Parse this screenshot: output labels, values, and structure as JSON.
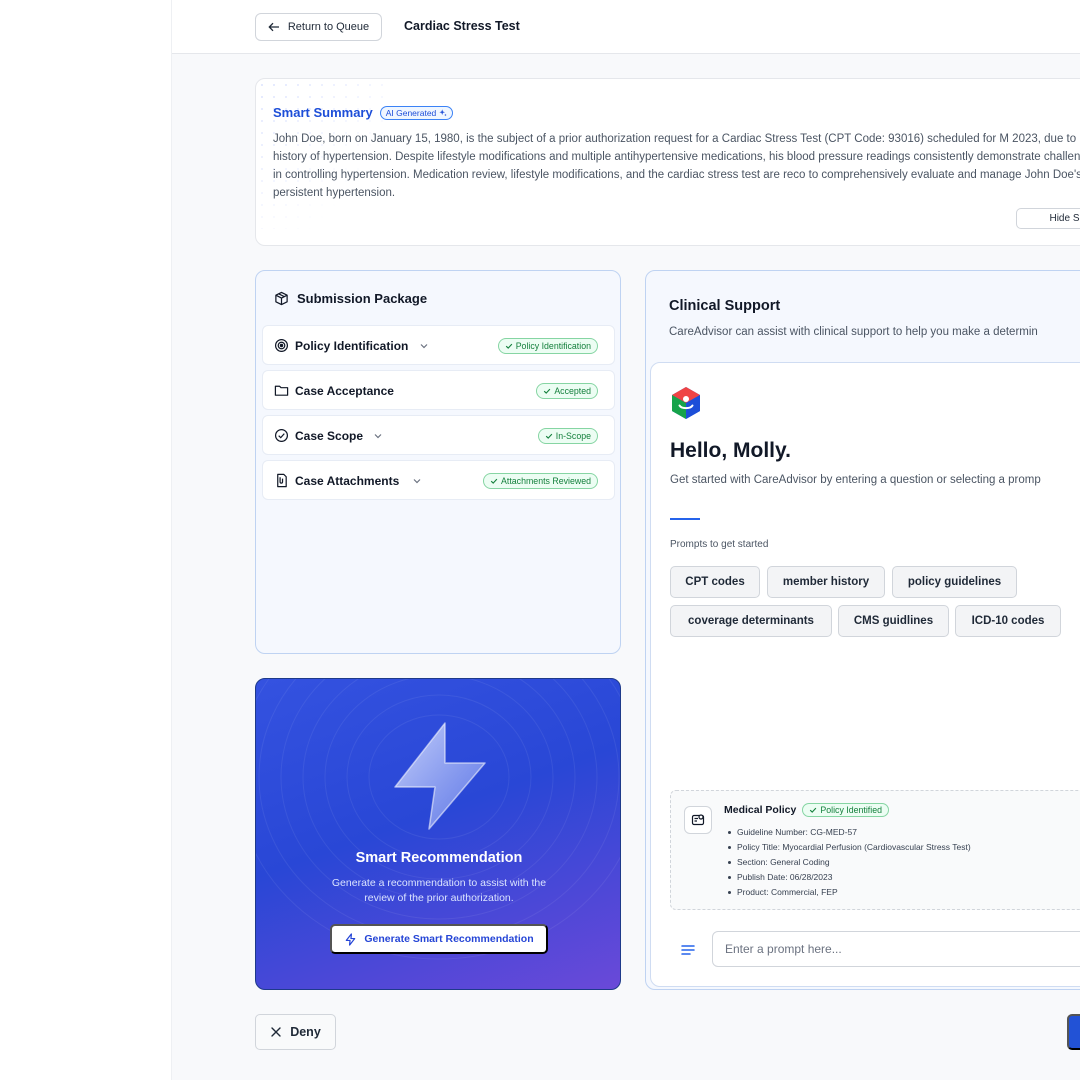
{
  "header": {
    "return_label": "Return to Queue",
    "page_title": "Cardiac Stress Test"
  },
  "summary": {
    "title": "Smart Summary",
    "badge": "AI Generated",
    "text": "John Doe, born on January 15, 1980, is the subject of a prior authorization request for a Cardiac Stress Test (CPT Code: 93016) scheduled for M 2023, due to his history of hypertension. Despite lifestyle modifications and multiple antihypertensive medications, his blood pressure readings consistently demonstrate challenges in controlling hypertension. Medication review, lifestyle modifications, and the cardiac stress test are reco to comprehensively evaluate and manage John Doe's persistent hypertension.",
    "hide_label": "Hide Smart"
  },
  "package": {
    "title": "Submission Package",
    "items": [
      {
        "label": "Policy Identification",
        "status": "Policy Identification",
        "icon": "target-icon",
        "expandable": true
      },
      {
        "label": "Case Acceptance",
        "status": "Accepted",
        "icon": "folder-icon",
        "expandable": false
      },
      {
        "label": "Case Scope",
        "status": "In-Scope",
        "icon": "check-circle-icon",
        "expandable": true
      },
      {
        "label": "Case Attachments",
        "status": "Attachments Reviewed",
        "icon": "attachment-icon",
        "expandable": true
      }
    ]
  },
  "recommendation": {
    "title": "Smart Recommendation",
    "description": "Generate a recommendation to assist with the review of the prior authorization.",
    "button_label": "Generate Smart Recommendation"
  },
  "clinical": {
    "title": "Clinical Support",
    "description": "CareAdvisor can assist with clinical support to help you make a determin",
    "greeting": "Hello, Molly.",
    "intro": "Get started with CareAdvisor by entering a question or selecting a promp",
    "prompts_label": "Prompts to get started",
    "prompts": [
      "CPT codes",
      "member history",
      "policy guidelines",
      "coverage determinants",
      "CMS guidlines",
      "ICD-10 codes"
    ],
    "policy": {
      "title": "Medical Policy",
      "badge": "Policy Identified",
      "lines": [
        "Guideline Number: CG-MED-57",
        "Policy Title: Myocardial Perfusion (Cardiovascular Stress Test)",
        "Section: General Coding",
        "Publish Date: 06/28/2023",
        "Product: Commercial, FEP"
      ]
    },
    "input_placeholder": "Enter a prompt here..."
  },
  "footer": {
    "deny_label": "Deny"
  },
  "colors": {
    "accent": "#2563eb",
    "success": "#15803d",
    "recommendation_bg": "#2947d6"
  }
}
